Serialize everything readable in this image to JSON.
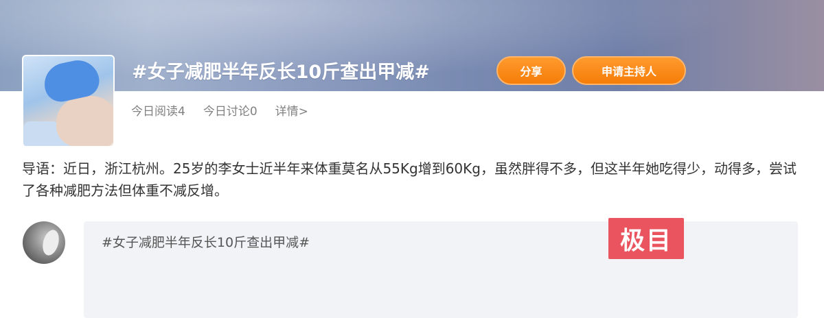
{
  "topic": {
    "title": "#女子减肥半年反长10斤查出甲减#",
    "share_label": "分享",
    "apply_host_label": "申请主持人",
    "thumbnail_icon": "medical-exam-photo"
  },
  "stats": {
    "read_today": "今日阅读4",
    "discuss_today": "今日讨论0",
    "details_link": "详情>"
  },
  "lead": {
    "text": "导语：近日，浙江杭州。25岁的李女士近半年来体重莫名从55Kg增到60Kg，虽然胖得不多，但这半年她吃得少，动得多，尝试了各种减肥方法但体重不减反增。"
  },
  "reply": {
    "text": "#女子减肥半年反长10斤查出甲减#"
  },
  "watermark": {
    "logo_text": "极目"
  },
  "colors": {
    "accent_orange": "#f57d08",
    "watermark_red": "#e9545f"
  }
}
